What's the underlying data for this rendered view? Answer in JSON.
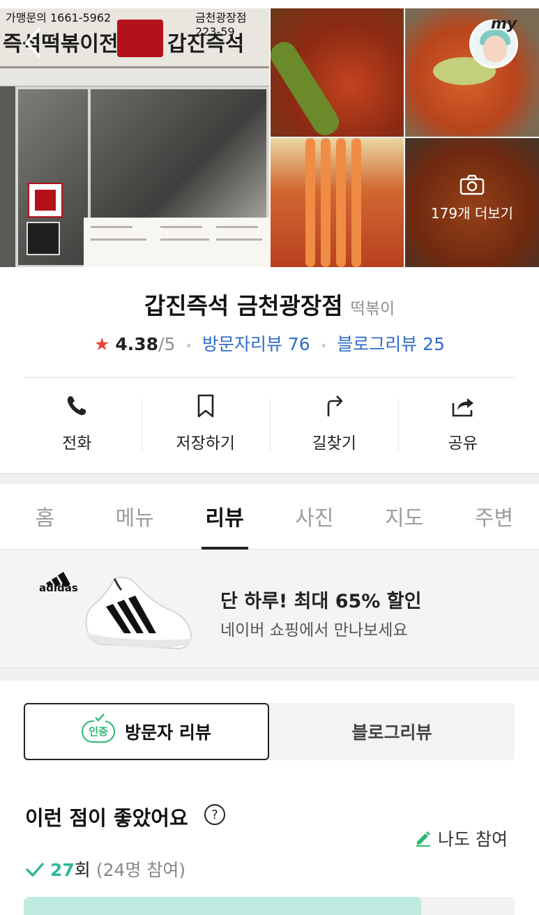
{
  "header": {
    "back_icon": "chevron-left-icon",
    "my_label": "my"
  },
  "gallery": {
    "sign_text_left": "즉석떡볶이전문점",
    "sign_text_right": "갑진즉석",
    "sign_phone": "가맹문의 1661-5962",
    "sign_branch": "금천광장점 223-59",
    "more_photos_label": "179개 더보기"
  },
  "place": {
    "name": "갑진즉석 금천광장점",
    "category": "떡볶이",
    "rating": "4.38",
    "rating_max": "/5",
    "visitor_reviews": "방문자리뷰 76",
    "blog_reviews": "블로그리뷰 25"
  },
  "actions": [
    {
      "label": "전화",
      "icon": "phone-icon"
    },
    {
      "label": "저장하기",
      "icon": "bookmark-icon"
    },
    {
      "label": "길찾기",
      "icon": "directions-icon"
    },
    {
      "label": "공유",
      "icon": "share-icon"
    }
  ],
  "tabs": [
    {
      "label": "홈"
    },
    {
      "label": "메뉴"
    },
    {
      "label": "리뷰",
      "active": true
    },
    {
      "label": "사진"
    },
    {
      "label": "지도"
    },
    {
      "label": "주변"
    }
  ],
  "ad": {
    "brand": "adidas",
    "title": "단 하루! 최대 65% 할인",
    "subtitle": "네이버 쇼핑에서 만나보세요"
  },
  "review_toggle": {
    "cert_badge": "인증",
    "visitor_label": "방문자 리뷰",
    "blog_label": "블로그리뷰"
  },
  "liked": {
    "title": "이런 점이 좋았어요",
    "join_label": "나도 참여",
    "count": "27",
    "count_unit": "회",
    "participants": "(24명 참여)",
    "first_bar_fill_fraction": 0.81
  },
  "colors": {
    "star": "#e8443a",
    "link_blue": "#2d6cc9",
    "accent_green": "#2eb872",
    "teal": "#2eb89b",
    "bar_fill": "#bfeae0"
  }
}
